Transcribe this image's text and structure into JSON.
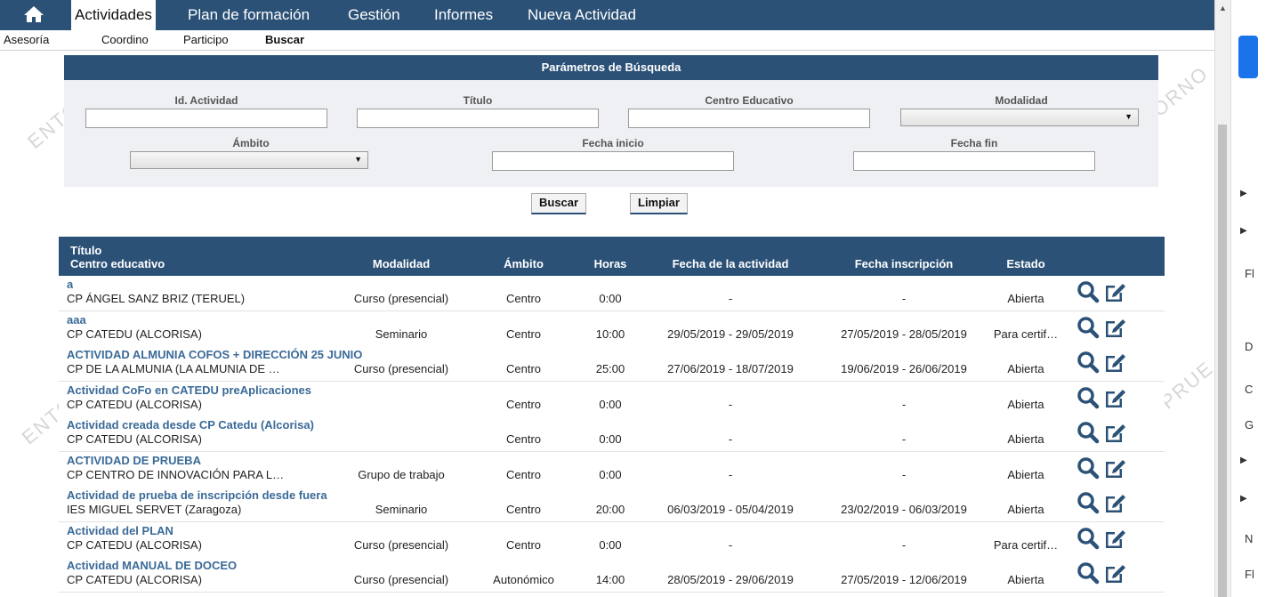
{
  "nav": {
    "items": [
      "Actividades",
      "Plan de formación",
      "Gestión",
      "Informes",
      "Nueva Actividad"
    ]
  },
  "subnav": {
    "items": [
      "Asesoría",
      "Coordino",
      "Participo",
      "Buscar"
    ]
  },
  "search": {
    "header": "Parámetros de Búsqueda",
    "labels": {
      "id": "Id. Actividad",
      "titulo": "Título",
      "centro": "Centro Educativo",
      "modalidad": "Modalidad",
      "ambito": "Ámbito",
      "fecha_inicio": "Fecha inicio",
      "fecha_fin": "Fecha fin"
    },
    "buttons": {
      "buscar": "Buscar",
      "limpiar": "Limpiar"
    }
  },
  "table": {
    "headers": {
      "titulo": "Título",
      "centro": "Centro educativo",
      "modalidad": "Modalidad",
      "ambito": "Ámbito",
      "horas": "Horas",
      "fecha_actividad": "Fecha de la actividad",
      "fecha_inscripcion": "Fecha inscripción",
      "estado": "Estado"
    },
    "rows": [
      {
        "titulo": "a",
        "centro": "CP ÁNGEL SANZ BRIZ (TERUEL)",
        "modalidad": "Curso (presencial)",
        "ambito": "Centro",
        "horas": "0:00",
        "fecha_actividad": "-",
        "fecha_inscripcion": "-",
        "estado": "Abierta"
      },
      {
        "titulo": "aaa",
        "centro": "CP CATEDU (ALCORISA)",
        "modalidad": "Seminario",
        "ambito": "Centro",
        "horas": "10:00",
        "fecha_actividad": "29/05/2019 - 29/05/2019",
        "fecha_inscripcion": "27/05/2019 - 28/05/2019",
        "estado": "Para certif…"
      },
      {
        "titulo": "ACTIVIDAD ALMUNIA COFOS + DIRECCIÓN 25 JUNIO",
        "centro": "CP DE LA ALMUNIA (LA ALMUNIA DE …",
        "modalidad": "Curso (presencial)",
        "ambito": "Centro",
        "horas": "25:00",
        "fecha_actividad": "27/06/2019 - 18/07/2019",
        "fecha_inscripcion": "19/06/2019 - 26/06/2019",
        "estado": "Abierta"
      },
      {
        "titulo": "Actividad CoFo en CATEDU preAplicaciones",
        "centro": "CP CATEDU (ALCORISA)",
        "modalidad": "",
        "ambito": "Centro",
        "horas": "0:00",
        "fecha_actividad": "-",
        "fecha_inscripcion": "-",
        "estado": "Abierta"
      },
      {
        "titulo": "Actividad creada desde CP Catedu (Alcorisa)",
        "centro": "CP CATEDU (ALCORISA)",
        "modalidad": "",
        "ambito": "Centro",
        "horas": "0:00",
        "fecha_actividad": "-",
        "fecha_inscripcion": "-",
        "estado": "Abierta"
      },
      {
        "titulo": "ACTIVIDAD DE PRUEBA",
        "centro": "CP CENTRO DE INNOVACIÓN PARA L…",
        "modalidad": "Grupo de trabajo",
        "ambito": "Centro",
        "horas": "0:00",
        "fecha_actividad": "-",
        "fecha_inscripcion": "-",
        "estado": "Abierta"
      },
      {
        "titulo": "Actividad de prueba de inscripción desde fuera",
        "centro": "IES MIGUEL SERVET (Zaragoza)",
        "modalidad": "Seminario",
        "ambito": "Centro",
        "horas": "20:00",
        "fecha_actividad": "06/03/2019 - 05/04/2019",
        "fecha_inscripcion": "23/02/2019 - 06/03/2019",
        "estado": "Abierta"
      },
      {
        "titulo": "Actividad del PLAN",
        "centro": "CP CATEDU (ALCORISA)",
        "modalidad": "Curso (presencial)",
        "ambito": "Centro",
        "horas": "0:00",
        "fecha_actividad": "-",
        "fecha_inscripcion": "-",
        "estado": "Para certif…"
      },
      {
        "titulo": "Actividad MANUAL DE DOCEO",
        "centro": "CP CATEDU (ALCORISA)",
        "modalidad": "Curso (presencial)",
        "ambito": "Autonómico",
        "horas": "14:00",
        "fecha_actividad": "28/05/2019 - 29/06/2019",
        "fecha_inscripcion": "27/05/2019 - 12/06/2019",
        "estado": "Abierta"
      }
    ]
  },
  "right_panel": {
    "letters": [
      "D",
      "C",
      "G",
      "N",
      "Fl"
    ]
  },
  "colors": {
    "nav_bg": "#2b5177",
    "link": "#3a6a98",
    "panel_bg": "#eef0f3"
  }
}
